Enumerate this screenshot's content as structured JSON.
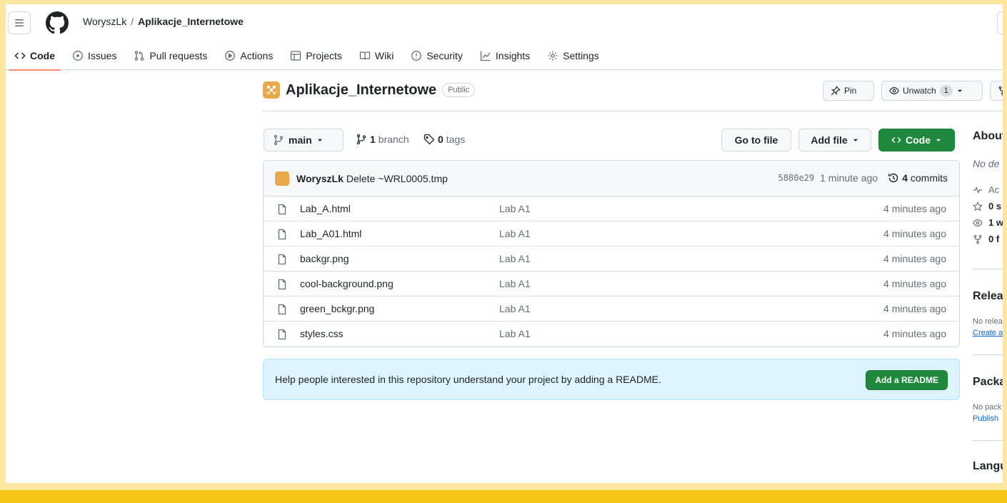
{
  "header": {
    "owner": "WoryszLk",
    "separator": "/",
    "repo": "Aplikacje_Internetowe"
  },
  "tabs": [
    {
      "label": "Code",
      "icon": "code-icon",
      "active": true
    },
    {
      "label": "Issues",
      "icon": "issue-icon"
    },
    {
      "label": "Pull requests",
      "icon": "pull-request-icon"
    },
    {
      "label": "Actions",
      "icon": "play-icon"
    },
    {
      "label": "Projects",
      "icon": "table-icon"
    },
    {
      "label": "Wiki",
      "icon": "book-icon"
    },
    {
      "label": "Security",
      "icon": "shield-icon"
    },
    {
      "label": "Insights",
      "icon": "graph-icon"
    },
    {
      "label": "Settings",
      "icon": "gear-icon"
    }
  ],
  "repo": {
    "name": "Aplikacje_Internetowe",
    "visibility": "Public",
    "pin_label": "Pin",
    "unwatch_label": "Unwatch",
    "watch_count": "1"
  },
  "branch": {
    "current": "main",
    "branch_count": "1",
    "branch_label": "branch",
    "tag_count": "0",
    "tag_label": "tags"
  },
  "actions": {
    "goto_file": "Go to file",
    "add_file": "Add file",
    "code": "Code"
  },
  "latest_commit": {
    "author": "WoryszLk",
    "message": "Delete ~WRL0005.tmp",
    "sha": "5880e29",
    "time": "1 minute ago",
    "commits_count": "4",
    "commits_label": "commits"
  },
  "files": [
    {
      "name": "Lab_A.html",
      "message": "Lab A1",
      "age": "4 minutes ago"
    },
    {
      "name": "Lab_A01.html",
      "message": "Lab A1",
      "age": "4 minutes ago"
    },
    {
      "name": "backgr.png",
      "message": "Lab A1",
      "age": "4 minutes ago"
    },
    {
      "name": "cool-background.png",
      "message": "Lab A1",
      "age": "4 minutes ago"
    },
    {
      "name": "green_bckgr.png",
      "message": "Lab A1",
      "age": "4 minutes ago"
    },
    {
      "name": "styles.css",
      "message": "Lab A1",
      "age": "4 minutes ago"
    }
  ],
  "readme_banner": {
    "text": "Help people interested in this repository understand your project by adding a README.",
    "button": "Add a README"
  },
  "sidebar": {
    "about_heading": "About",
    "about_desc": "No de",
    "activity": "Ac",
    "stars": "0 s",
    "watching": "1 w",
    "forks": "0 f",
    "releases_heading": "Releas",
    "releases_text": "No relea",
    "releases_link": "Create a",
    "packages_heading": "Packa",
    "packages_text": "No pack",
    "packages_link": "Publish",
    "languages_heading": "Langu"
  },
  "colors": {
    "accent_tab": "#fd8c73",
    "primary_button": "#1f883d",
    "banner_bg": "#ddf4ff",
    "frame": "#fde7a0",
    "frame_bar": "#f5c518"
  }
}
